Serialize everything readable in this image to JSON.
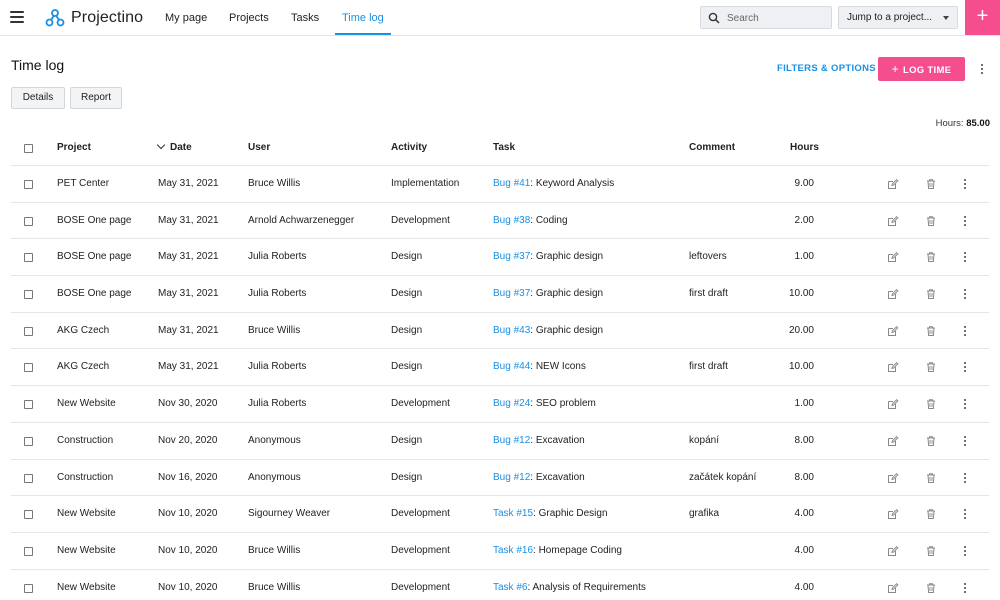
{
  "brand": {
    "name": "Projectino",
    "logo_icon": "molecule-logo-icon",
    "accent": "#1a8fe3",
    "primary_button": "#f54e8f"
  },
  "nav": {
    "items": [
      {
        "label": "My page"
      },
      {
        "label": "Projects"
      },
      {
        "label": "Tasks"
      },
      {
        "label": "Time log",
        "active": true
      }
    ],
    "search_placeholder": "Search",
    "jump_label": "Jump to a project...",
    "add_label": "+"
  },
  "page": {
    "title": "Time log",
    "filters_label": "FILTERS & OPTIONS",
    "log_time_label": "LOG TIME",
    "log_time_plus": "+",
    "tabs": [
      {
        "label": "Details"
      },
      {
        "label": "Report"
      }
    ],
    "hours_label": "Hours:",
    "hours_total": "85.00"
  },
  "table": {
    "columns": [
      "Project",
      "Date",
      "User",
      "Activity",
      "Task",
      "Comment",
      "Hours"
    ],
    "sorted_column": "Date",
    "rows": [
      {
        "project": "PET Center",
        "date": "May 31, 2021",
        "user": "Bruce Willis",
        "activity": "Implementation",
        "task_ref": "Bug #41",
        "task_name": ": Keyword Analysis",
        "comment": "",
        "hours": "9.00"
      },
      {
        "project": "BOSE One page",
        "date": "May 31, 2021",
        "user": "Arnold Achwarzenegger",
        "activity": "Development",
        "task_ref": "Bug #38",
        "task_name": ": Coding",
        "comment": "",
        "hours": "2.00"
      },
      {
        "project": "BOSE One page",
        "date": "May 31, 2021",
        "user": "Julia Roberts",
        "activity": "Design",
        "task_ref": "Bug #37",
        "task_name": ": Graphic design",
        "comment": "leftovers",
        "hours": "1.00"
      },
      {
        "project": "BOSE One page",
        "date": "May 31, 2021",
        "user": "Julia Roberts",
        "activity": "Design",
        "task_ref": "Bug #37",
        "task_name": ": Graphic design",
        "comment": "first draft",
        "hours": "10.00"
      },
      {
        "project": "AKG Czech",
        "date": "May 31, 2021",
        "user": "Bruce Willis",
        "activity": "Design",
        "task_ref": "Bug #43",
        "task_name": ": Graphic design",
        "comment": "",
        "hours": "20.00"
      },
      {
        "project": "AKG Czech",
        "date": "May 31, 2021",
        "user": "Julia Roberts",
        "activity": "Design",
        "task_ref": "Bug #44",
        "task_name": ": NEW Icons",
        "comment": "first draft",
        "hours": "10.00"
      },
      {
        "project": "New Website",
        "date": "Nov 30, 2020",
        "user": "Julia Roberts",
        "activity": "Development",
        "task_ref": "Bug #24",
        "task_name": ": SEO problem",
        "comment": "",
        "hours": "1.00"
      },
      {
        "project": "Construction",
        "date": "Nov 20, 2020",
        "user": "Anonymous",
        "activity": "Design",
        "task_ref": "Bug #12",
        "task_name": ": Excavation",
        "comment": "kopání",
        "hours": "8.00"
      },
      {
        "project": "Construction",
        "date": "Nov 16, 2020",
        "user": "Anonymous",
        "activity": "Design",
        "task_ref": "Bug #12",
        "task_name": ": Excavation",
        "comment": "začátek kopání",
        "hours": "8.00"
      },
      {
        "project": "New Website",
        "date": "Nov 10, 2020",
        "user": "Sigourney Weaver",
        "activity": "Development",
        "task_ref": "Task #15",
        "task_name": ": Graphic Design",
        "comment": "grafika",
        "hours": "4.00"
      },
      {
        "project": "New Website",
        "date": "Nov 10, 2020",
        "user": "Bruce Willis",
        "activity": "Development",
        "task_ref": "Task #16",
        "task_name": ": Homepage Coding",
        "comment": "",
        "hours": "4.00"
      },
      {
        "project": "New Website",
        "date": "Nov 10, 2020",
        "user": "Bruce Willis",
        "activity": "Development",
        "task_ref": "Task #6",
        "task_name": ": Analysis of Requirements",
        "comment": "",
        "hours": "4.00"
      }
    ],
    "row_icons": [
      "edit-icon",
      "trash-icon",
      "more-vertical-icon"
    ]
  }
}
